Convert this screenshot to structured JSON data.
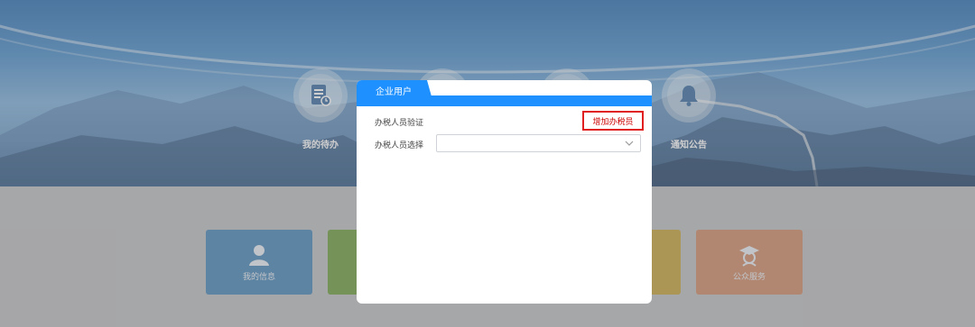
{
  "nav": {
    "items": [
      {
        "label": "我的待办",
        "icon": "todo-doc-icon"
      },
      {
        "label": "",
        "icon": "book-icon"
      },
      {
        "label": "",
        "icon": "grid-icon"
      },
      {
        "label": "通知公告",
        "icon": "bell-icon"
      }
    ]
  },
  "tiles": [
    {
      "label": "我的信息",
      "color": "#4a87b8",
      "icon": "user-icon"
    },
    {
      "label": "",
      "color": "#6e9e3f",
      "icon": ""
    },
    {
      "label": "",
      "color": "#c7a33b",
      "icon": ""
    },
    {
      "label": "公众服务",
      "color": "#cf8c6a",
      "icon": "graduate-icon"
    }
  ],
  "dialog": {
    "tab_title": "企业用户",
    "verify_label": "办税人员验证",
    "add_button": "增加办税员",
    "select_label": "办税人员选择",
    "select_value": ""
  },
  "colors": {
    "accent": "#1e90ff",
    "highlight_border": "#e02020"
  }
}
